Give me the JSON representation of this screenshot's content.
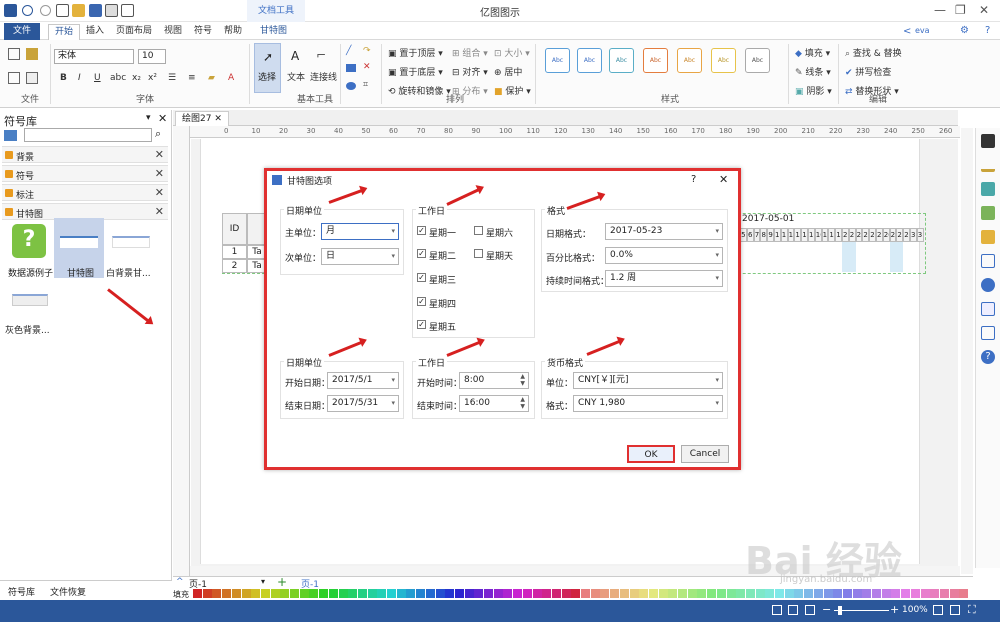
{
  "app": {
    "title": "亿图图示",
    "context_tab": "文档工具",
    "user": "eva"
  },
  "tabs": [
    "文件",
    "开始",
    "插入",
    "页面布局",
    "视图",
    "符号",
    "帮助",
    "甘特图"
  ],
  "ribbon": {
    "font_name": "宋体",
    "font_size": "10",
    "groups": [
      "文件",
      "字体",
      "基本工具",
      "排列",
      "样式",
      "编辑"
    ],
    "basic_tools": [
      "选择",
      "文本",
      "连接线"
    ],
    "arrange": [
      "置于顶层",
      "置于底层",
      "旋转和镜像",
      "组合",
      "对齐",
      "分布",
      "大小",
      "居中",
      "保护"
    ],
    "style_sample": "Abc",
    "format": [
      "填充",
      "线条",
      "阴影"
    ],
    "edit": [
      "查找 & 替换",
      "拼写检查",
      "替换形状"
    ]
  },
  "left_panel": {
    "title": "符号库",
    "libraries": [
      "背景",
      "符号",
      "标注",
      "甘特图"
    ],
    "thumbnails": [
      "数据源例子",
      "甘特图",
      "白背景甘...",
      "灰色背景..."
    ],
    "bottom_tabs": [
      "符号库",
      "文件恢复"
    ]
  },
  "document": {
    "tab": "绘图27",
    "page_nav": "页-1",
    "page_tab": "页-1",
    "fill_label": "填充"
  },
  "hruler_ticks": [
    "0",
    "10",
    "20",
    "30",
    "40",
    "50",
    "60",
    "70",
    "80",
    "90",
    "100",
    "110",
    "120",
    "130",
    "140",
    "150",
    "160",
    "170",
    "180",
    "190",
    "200",
    "210",
    "220",
    "230",
    "240",
    "250",
    "260"
  ],
  "gantt": {
    "header_id": "ID",
    "rows": [
      {
        "id": "1",
        "task": "Ta"
      },
      {
        "id": "2",
        "task": "Ta"
      }
    ],
    "month": "2017-05-01",
    "days": [
      "5",
      "6",
      "7",
      "8",
      "9",
      "10",
      "11",
      "12",
      "13",
      "14",
      "15",
      "16",
      "17",
      "18",
      "19",
      "20",
      "21",
      "22",
      "23",
      "24",
      "25",
      "26",
      "27",
      "28",
      "29",
      "30",
      "31"
    ]
  },
  "dialog": {
    "title": "甘特图选项",
    "help": "?",
    "close": "✕",
    "date_unit": {
      "title": "日期单位",
      "major_label": "主单位：",
      "major_value": "月",
      "minor_label": "次单位：",
      "minor_value": "日"
    },
    "workdays": {
      "title": "工作日",
      "days": [
        "星期一",
        "星期二",
        "星期三",
        "星期四",
        "星期五",
        "星期六",
        "星期天"
      ]
    },
    "format": {
      "title": "格式",
      "date_label": "日期格式：",
      "date_value": "2017-05-23",
      "percent_label": "百分比格式：",
      "percent_value": "0.0%",
      "duration_label": "持续时间格式：",
      "duration_value": "1.2 周"
    },
    "date_range": {
      "title": "日期单位",
      "start_label": "开始日期：",
      "start_value": "2017/5/1",
      "end_label": "结束日期：",
      "end_value": "2017/5/31"
    },
    "worktime": {
      "title": "工作日",
      "start_label": "开始时间：",
      "start_value": "8:00",
      "end_label": "结束时间：",
      "end_value": "16:00"
    },
    "currency": {
      "title": "货币格式",
      "unit_label": "单位：",
      "unit_value": "CNY[￥][元]",
      "format_label": "格式：",
      "format_value": "CNY 1,980"
    },
    "ok": "OK",
    "cancel": "Cancel"
  },
  "status": {
    "zoom": "100%"
  },
  "colors": {
    "accent": "#2b579a",
    "highlight": "#e03030"
  }
}
